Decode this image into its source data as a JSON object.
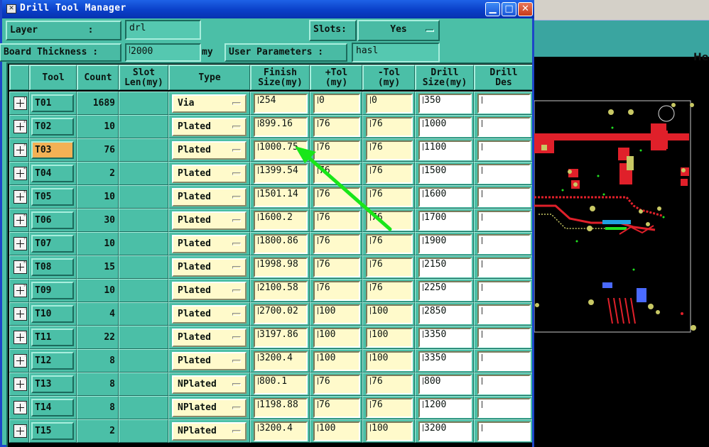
{
  "window": {
    "title": "Drill Tool Manager",
    "icon": "window-app-icon",
    "controls": [
      "minimize",
      "maximize",
      "close"
    ]
  },
  "form": {
    "layer_label": "Layer         :",
    "layer_value": "drl",
    "slots_label": "Slots:",
    "slots_value": "Yes",
    "thickness_label": "Board Thickness :",
    "thickness_value": "2000",
    "thickness_unit": "my",
    "user_params_label": "User Parameters :",
    "user_params_value": "hasl"
  },
  "table": {
    "headers": [
      "",
      "Tool",
      "Count",
      "Slot\nLen(my)",
      "Type",
      "Finish\nSize(my)",
      "+Tol\n(my)",
      "-Tol\n(my)",
      "Drill\nSize(my)",
      "Drill\nDes"
    ],
    "selected_tool": "T03",
    "rows": [
      {
        "tool": "T01",
        "count": "1689",
        "slot": "",
        "type": "Via",
        "finish": "254",
        "ptol": "0",
        "mtol": "0",
        "drill": "350",
        "des": ""
      },
      {
        "tool": "T02",
        "count": "10",
        "slot": "",
        "type": "Plated",
        "finish": "899.16",
        "ptol": "76",
        "mtol": "76",
        "drill": "1000",
        "des": ""
      },
      {
        "tool": "T03",
        "count": "76",
        "slot": "",
        "type": "Plated",
        "finish": "1000.75",
        "ptol": "76",
        "mtol": "76",
        "drill": "1100",
        "des": ""
      },
      {
        "tool": "T04",
        "count": "2",
        "slot": "",
        "type": "Plated",
        "finish": "1399.54",
        "ptol": "76",
        "mtol": "76",
        "drill": "1500",
        "des": ""
      },
      {
        "tool": "T05",
        "count": "10",
        "slot": "",
        "type": "Plated",
        "finish": "1501.14",
        "ptol": "76",
        "mtol": "76",
        "drill": "1600",
        "des": ""
      },
      {
        "tool": "T06",
        "count": "30",
        "slot": "",
        "type": "Plated",
        "finish": "1600.2",
        "ptol": "76",
        "mtol": "76",
        "drill": "1700",
        "des": ""
      },
      {
        "tool": "T07",
        "count": "10",
        "slot": "",
        "type": "Plated",
        "finish": "1800.86",
        "ptol": "76",
        "mtol": "76",
        "drill": "1900",
        "des": ""
      },
      {
        "tool": "T08",
        "count": "15",
        "slot": "",
        "type": "Plated",
        "finish": "1998.98",
        "ptol": "76",
        "mtol": "76",
        "drill": "2150",
        "des": ""
      },
      {
        "tool": "T09",
        "count": "10",
        "slot": "",
        "type": "Plated",
        "finish": "2100.58",
        "ptol": "76",
        "mtol": "76",
        "drill": "2250",
        "des": ""
      },
      {
        "tool": "T10",
        "count": "4",
        "slot": "",
        "type": "Plated",
        "finish": "2700.02",
        "ptol": "100",
        "mtol": "100",
        "drill": "2850",
        "des": ""
      },
      {
        "tool": "T11",
        "count": "22",
        "slot": "",
        "type": "Plated",
        "finish": "3197.86",
        "ptol": "100",
        "mtol": "100",
        "drill": "3350",
        "des": ""
      },
      {
        "tool": "T12",
        "count": "8",
        "slot": "",
        "type": "Plated",
        "finish": "3200.4",
        "ptol": "100",
        "mtol": "100",
        "drill": "3350",
        "des": ""
      },
      {
        "tool": "T13",
        "count": "8",
        "slot": "",
        "type": "NPlated",
        "finish": "800.1",
        "ptol": "76",
        "mtol": "76",
        "drill": "800",
        "des": ""
      },
      {
        "tool": "T14",
        "count": "8",
        "slot": "",
        "type": "NPlated",
        "finish": "1198.88",
        "ptol": "76",
        "mtol": "76",
        "drill": "1200",
        "des": ""
      },
      {
        "tool": "T15",
        "count": "2",
        "slot": "",
        "type": "NPlated",
        "finish": "3200.4",
        "ptol": "100",
        "mtol": "100",
        "drill": "3200",
        "des": ""
      }
    ]
  },
  "background_app": {
    "help_label": "Hel"
  },
  "annotation": {
    "arrow_color": "#19e619"
  },
  "colors": {
    "panel": "#4bbfa7",
    "input": "#fffacb",
    "selected_tool": "#f3b155",
    "titlebar": "#0a3fc8"
  }
}
